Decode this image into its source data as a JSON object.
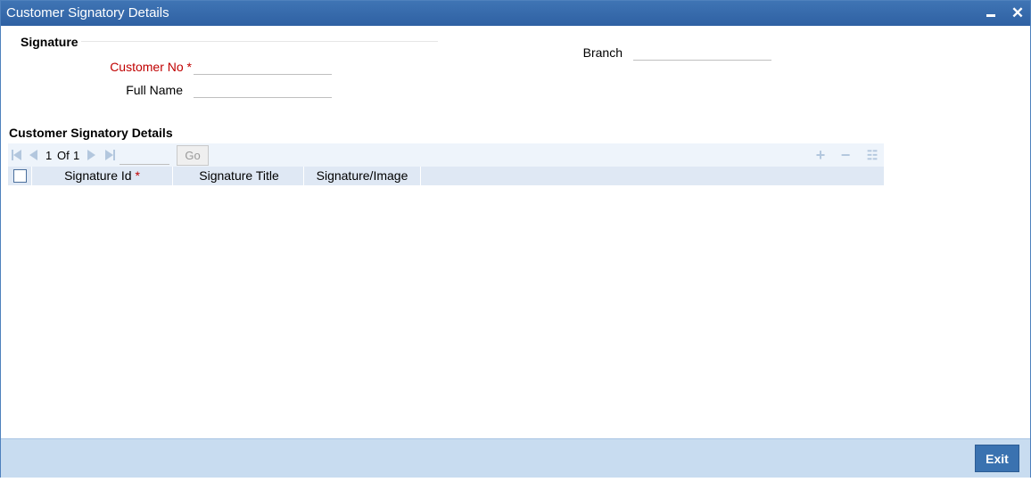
{
  "window": {
    "title": "Customer Signatory Details",
    "minimize_icon": "minimize-icon",
    "close_icon": "close-icon",
    "close_glyph": "✕"
  },
  "signature_section": {
    "label": "Signature",
    "customer_no": {
      "label": "Customer No",
      "required_mark": "*",
      "value": ""
    },
    "full_name": {
      "label": "Full Name",
      "value": ""
    },
    "branch": {
      "label": "Branch",
      "value": ""
    }
  },
  "details_section": {
    "label": "Customer Signatory Details",
    "pagination": {
      "current": "1",
      "of_label": "Of",
      "total": "1",
      "page_input_value": "",
      "go_label": "Go"
    },
    "toolbar": {
      "add_glyph": "+",
      "delete_glyph": "−",
      "view_glyph": "☷"
    },
    "columns": [
      {
        "label": "Signature Id",
        "required_mark": "*"
      },
      {
        "label": "Signature Title"
      },
      {
        "label": "Signature/Image"
      }
    ],
    "rows": []
  },
  "footer": {
    "exit_label": "Exit"
  },
  "colors": {
    "title_bar": "#3f74b4",
    "required": "#c00000",
    "footer": "#c8dcf0",
    "button": "#3a72b0"
  }
}
